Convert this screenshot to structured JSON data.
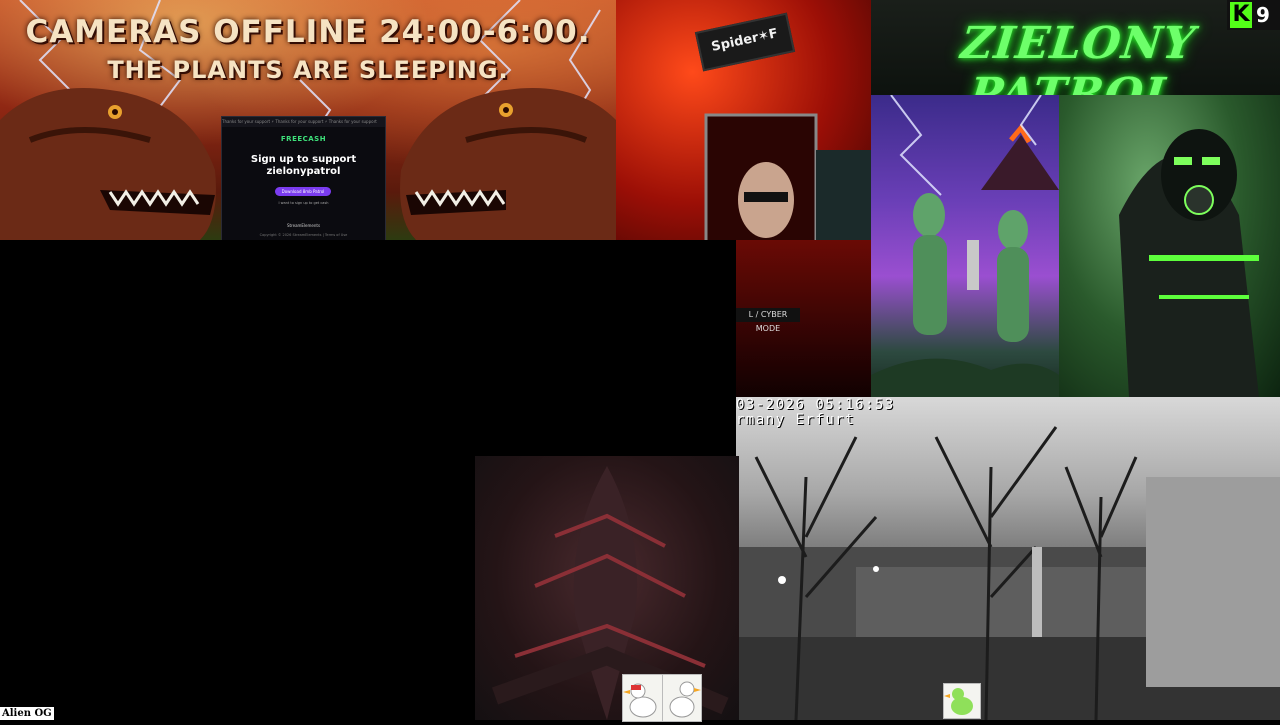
{
  "banner": {
    "line1": "CAMERAS OFFLINE 24:00-6:00.",
    "line2": "THE PLANTS ARE SLEEPING."
  },
  "freecash_popup": {
    "topbar_text": "Thanks for your support ⚡ Thanks for your support ⚡ Thanks for your support",
    "logo": "FREECASH",
    "heading_line1": "Sign up to support",
    "heading_line2": "zielonypatrol",
    "button_label": "Download 8mb Patrol",
    "small_text": "I want to sign up to get cash",
    "footer_logo": "StreamElements",
    "footer_copy": "Copyright © 2026 StreamElements | Terms of Use"
  },
  "spider_tile": {
    "sign_text": "Spider✶F",
    "bottom_text": "L / CYBER MODE"
  },
  "neon_sign": {
    "title": "ZIELONY PATROL"
  },
  "kick_badge": {
    "letter": "K",
    "count": "9"
  },
  "cctv": {
    "timestamp": "03-2026 05:16:53",
    "location": "rmany Erfurt"
  },
  "bottom_label": "Alien OG",
  "colors": {
    "neon_green": "#6dff6a",
    "kick_green": "#53fc18",
    "freecash_green": "#3ee07a",
    "freecash_purple": "#7b3cf0"
  },
  "icons": [
    "kick-logo-icon",
    "lightning-icon",
    "goose-sticker-icon"
  ]
}
